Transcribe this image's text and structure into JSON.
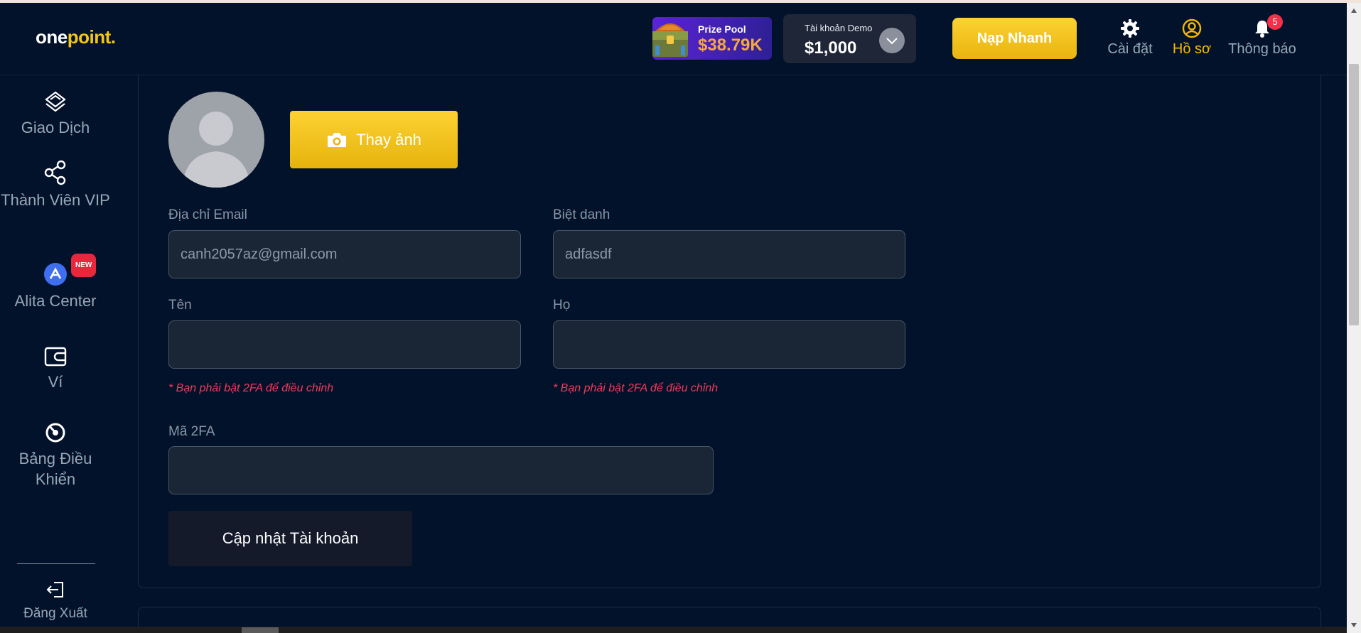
{
  "header": {
    "logo_main": "one",
    "logo_accent": "point.",
    "prize_pool": {
      "label": "Prize Pool",
      "value": "$38.79K"
    },
    "demo_account": {
      "label": "Tài khoản Demo",
      "balance": "$1,000"
    },
    "deposit_label": "Nạp Nhanh",
    "nav": {
      "settings": "Cài đặt",
      "profile": "Hồ sơ",
      "notifications": "Thông báo",
      "notification_count": "5"
    }
  },
  "sidebar": {
    "items": [
      {
        "label": "Giao Dịch",
        "icon": "trade-icon"
      },
      {
        "label": "Thành Viên VIP",
        "icon": "share-network-icon"
      },
      {
        "label": "Alita Center",
        "icon": "alita-logo-icon",
        "badge": "NEW"
      },
      {
        "label": "Ví",
        "icon": "wallet-icon"
      },
      {
        "label": "Bảng Điều Khiển",
        "icon": "dashboard-icon"
      }
    ],
    "logout_label": "Đăng Xuất"
  },
  "profile": {
    "change_photo_label": "Thay ảnh",
    "email": {
      "label": "Địa chỉ Email",
      "value": "canh2057az@gmail.com"
    },
    "nickname": {
      "label": "Biệt danh",
      "value": "adfasdf"
    },
    "first_name": {
      "label": "Tên",
      "value": ""
    },
    "last_name": {
      "label": "Họ",
      "value": ""
    },
    "twofa_hint": "* Bạn phải bật 2FA để điều chỉnh",
    "twofa_code": {
      "label": "Mã 2FA",
      "value": ""
    },
    "update_label": "Cập nhật Tài khoản"
  },
  "colors": {
    "background": "#02122a",
    "accent": "#f5c518",
    "warning": "#f23b5a",
    "prize_value": "#f7a93b"
  }
}
